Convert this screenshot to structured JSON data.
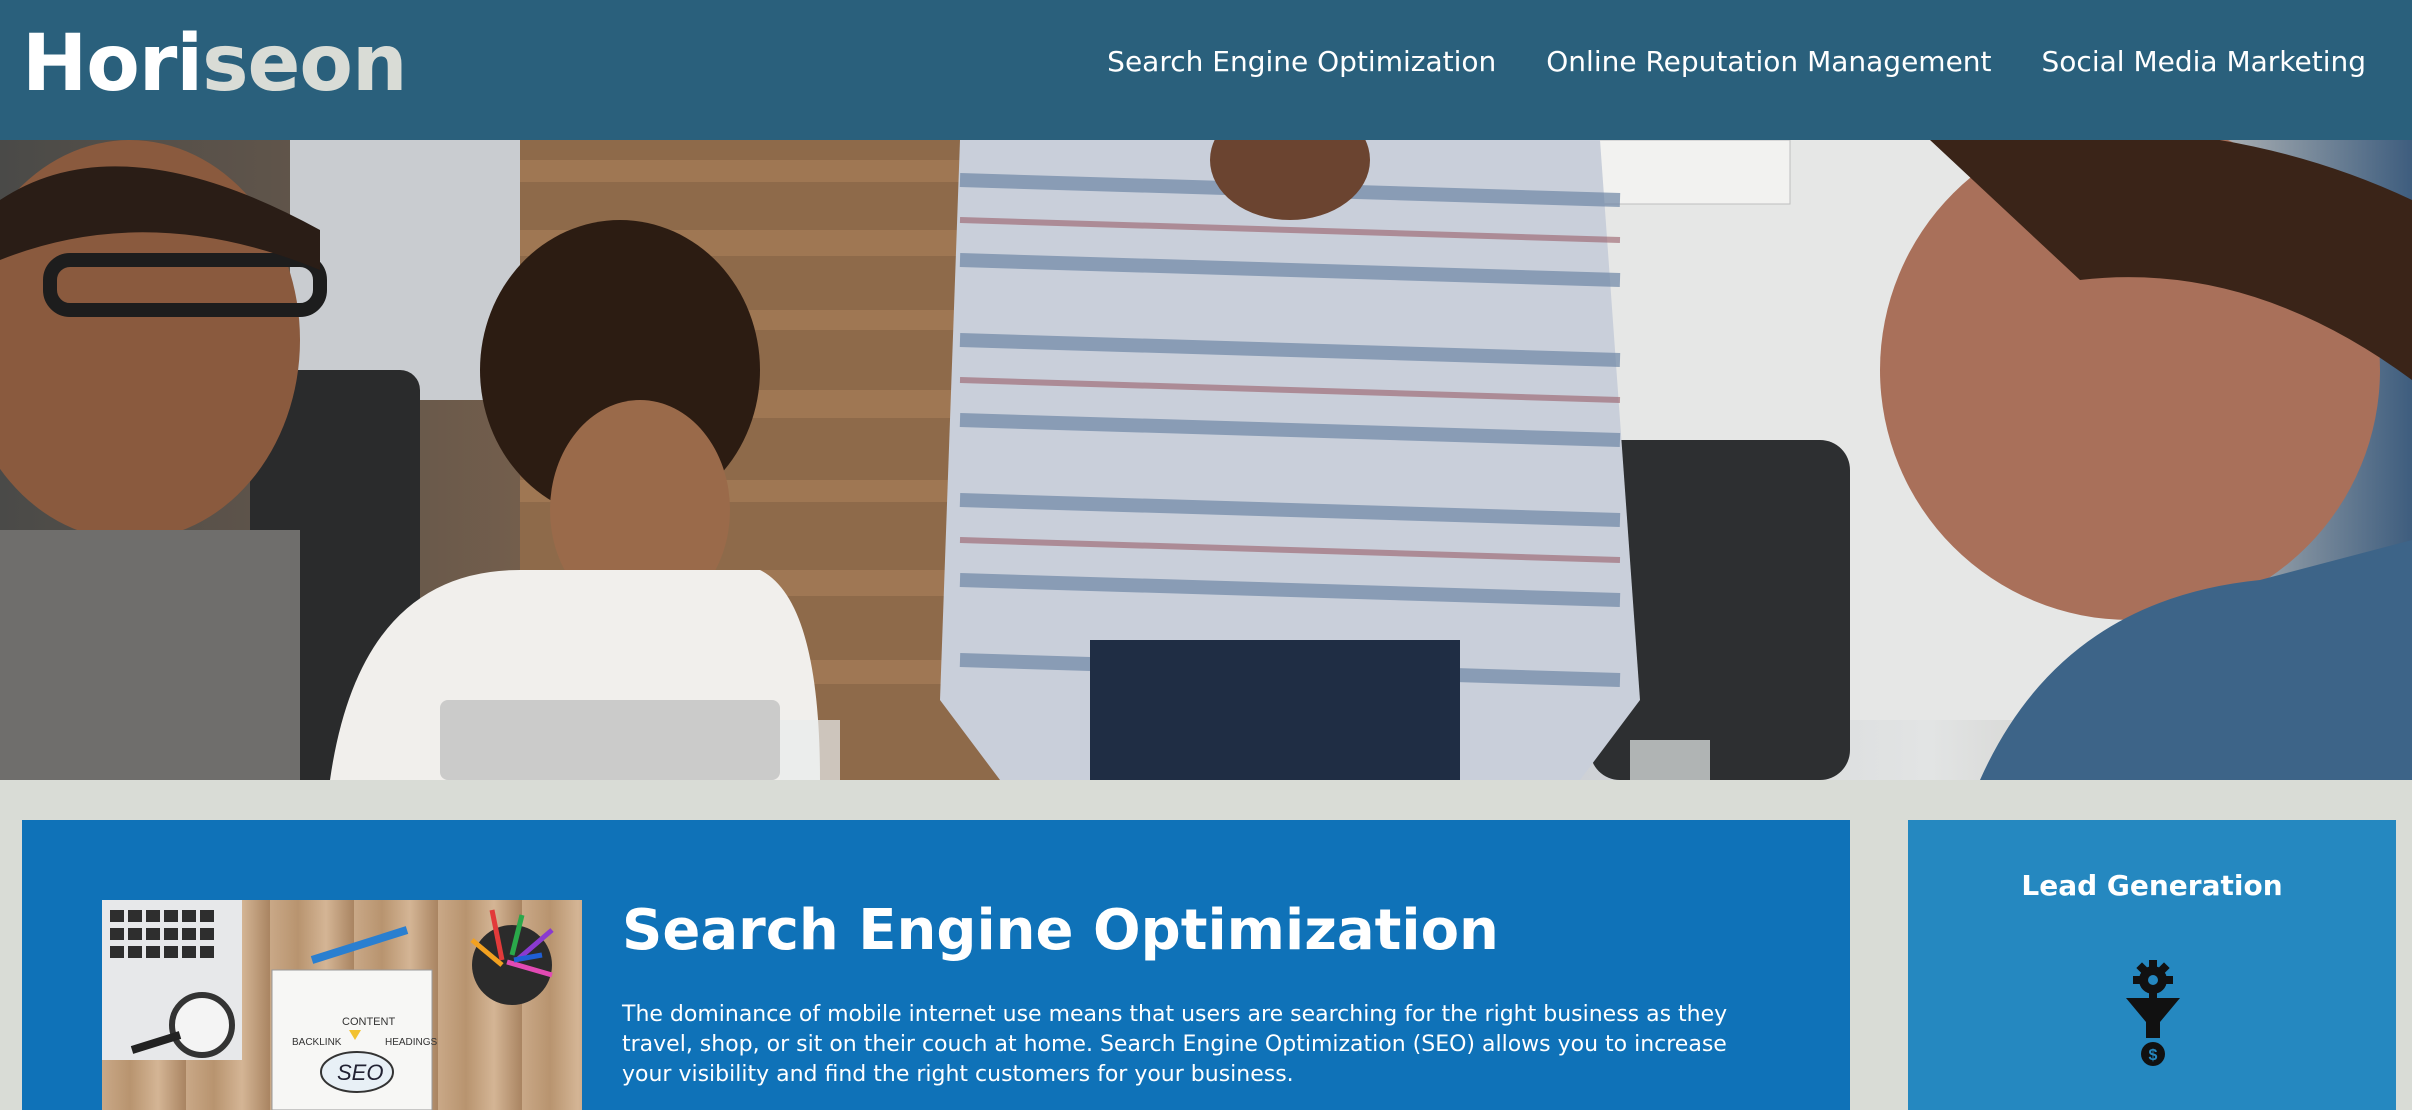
{
  "header": {
    "logo_part1": "Hori",
    "logo_part2": "seon",
    "nav": [
      {
        "label": "Search Engine Optimization"
      },
      {
        "label": "Online Reputation Management"
      },
      {
        "label": "Social Media Marketing"
      }
    ]
  },
  "hero": {
    "icon": "team-meeting-photo"
  },
  "content": {
    "seo": {
      "title": "Search Engine Optimization",
      "text": "The dominance of mobile internet use means that users are searching for the right business as they travel, shop, or sit on their couch at home. Search Engine Optimization (SEO) allows you to increase your visibility and find the right customers for your business.",
      "image_labels": [
        "CONTENT",
        "BACKLINK",
        "HEADINGS",
        "SEO"
      ]
    }
  },
  "sidebar": {
    "lead_generation": {
      "title": "Lead Generation",
      "icon": "funnel-gear-dollar-icon"
    }
  },
  "colors": {
    "header_bg": "#2a607c",
    "page_bg": "#d9dcd6",
    "content_bg": "#0f72b8",
    "sidebar_bg": "#2588c0",
    "logo_accent": "#d9dcd6"
  }
}
